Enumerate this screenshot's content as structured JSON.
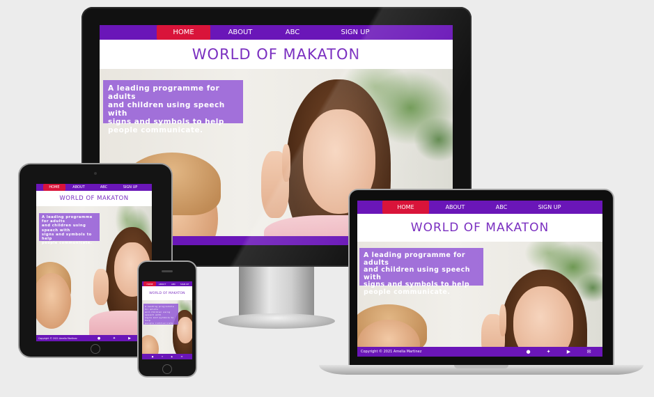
{
  "site": {
    "nav": [
      "HOME",
      "ABOUT",
      "ABC",
      "SIGN UP"
    ],
    "active_nav": "HOME",
    "title": "WORLD OF MAKATON",
    "tagline_lines": [
      "A leading programme for adults",
      "and children using speech with",
      "signs and symbols to help",
      "people communicate."
    ],
    "copyright": "Copyright © 2021 Amelia Martinez"
  },
  "footer_icons": [
    "facebook-icon",
    "twitter-icon",
    "youtube-icon",
    "envelope-icon"
  ],
  "colors": {
    "nav": "#6a16b8",
    "active": "#d9143a",
    "title": "#7a2fc0",
    "tagline_bg": "#965fd7"
  }
}
